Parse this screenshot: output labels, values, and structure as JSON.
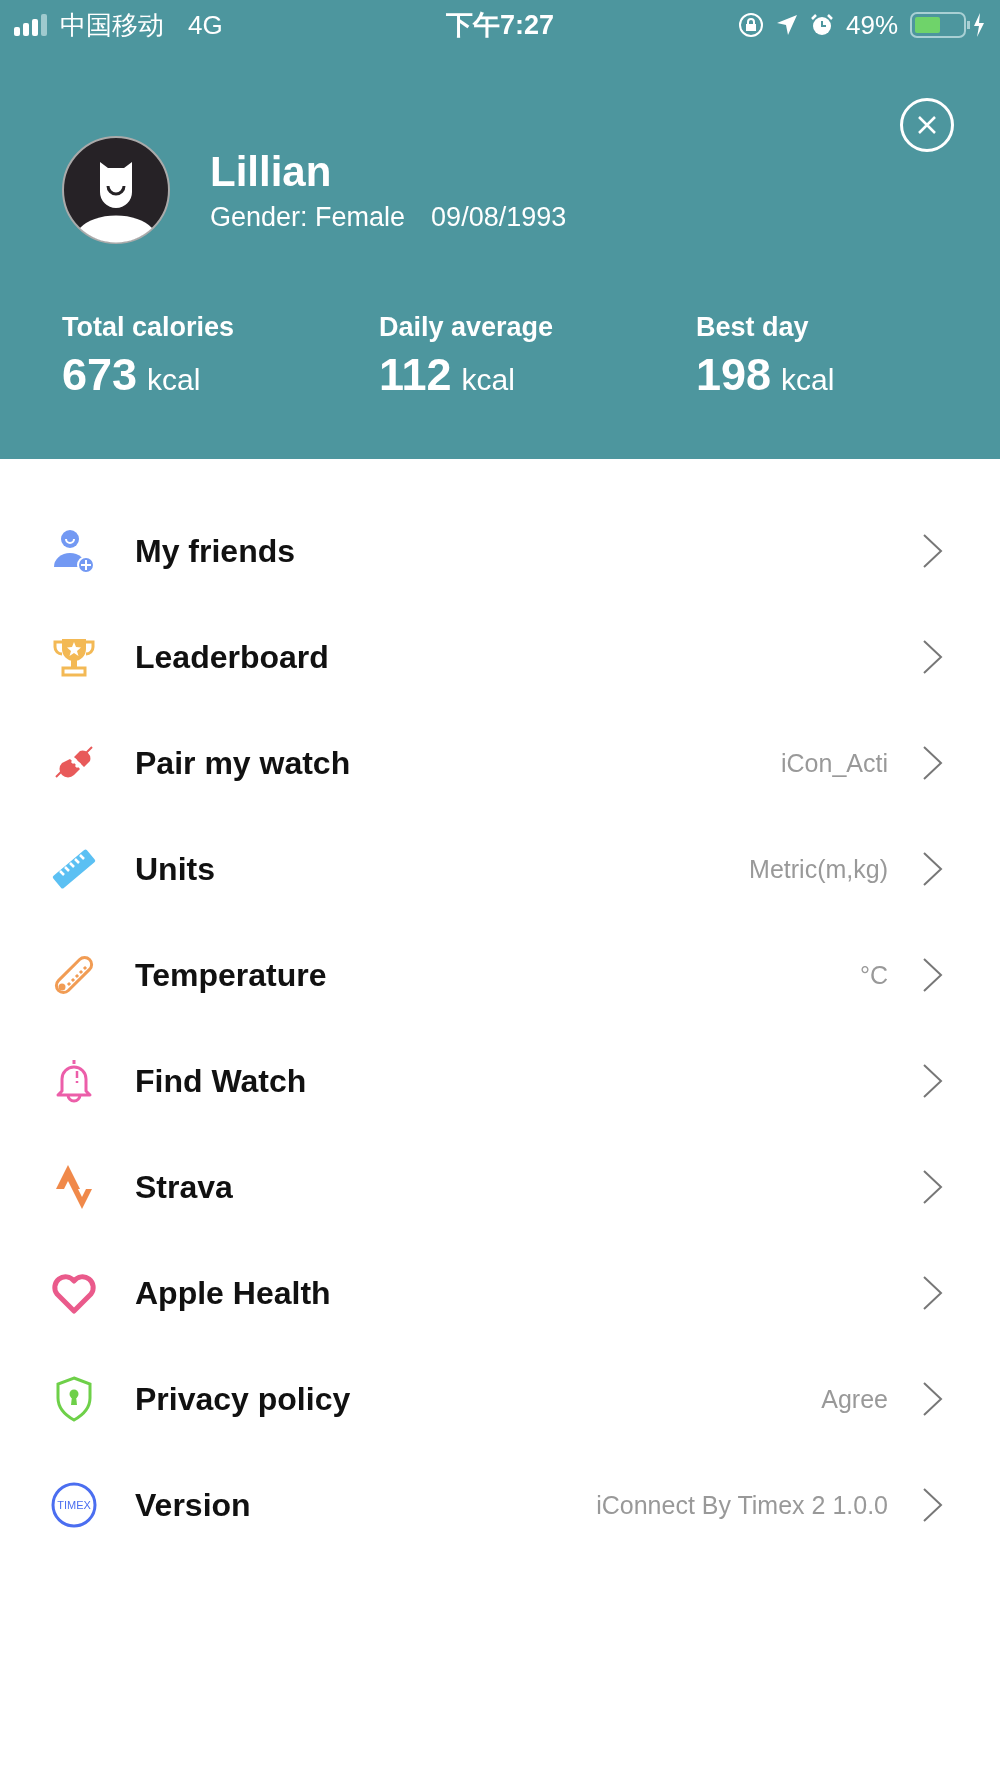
{
  "status_bar": {
    "carrier": "中国移动",
    "network": "4G",
    "time": "下午7:27",
    "battery": "49%"
  },
  "profile": {
    "name": "Lillian",
    "gender": "Gender: Female",
    "birthday": "09/08/1993"
  },
  "stats": [
    {
      "label": "Total calories",
      "value": "673",
      "unit": "kcal"
    },
    {
      "label": "Daily average",
      "value": "112",
      "unit": "kcal"
    },
    {
      "label": "Best day",
      "value": "198",
      "unit": "kcal"
    }
  ],
  "menu": [
    {
      "kind": "friends",
      "label": "My friends"
    },
    {
      "kind": "trophy",
      "label": "Leaderboard"
    },
    {
      "kind": "plug",
      "label": "Pair my watch",
      "value": "iCon_Acti"
    },
    {
      "kind": "ruler",
      "label": "Units",
      "value": "Metric(m,kg)"
    },
    {
      "kind": "thermometer",
      "label": "Temperature",
      "value": "°C"
    },
    {
      "kind": "bell",
      "label": "Find Watch"
    },
    {
      "kind": "strava",
      "label": "Strava"
    },
    {
      "kind": "heart",
      "label": "Apple Health"
    },
    {
      "kind": "shield",
      "label": "Privacy policy",
      "value": "Agree"
    },
    {
      "kind": "timex",
      "label": "Version",
      "value": "iConnect By Timex 2 1.0.0",
      "icon_text": "TIMEX"
    }
  ]
}
